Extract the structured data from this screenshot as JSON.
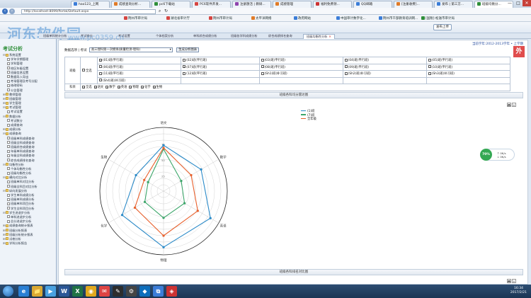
{
  "browser": {
    "tabs": [
      {
        "label": "hao123_上网",
        "color": "#3b7dd8"
      },
      {
        "label": "成绩查询分析...",
        "color": "#e07b28"
      },
      {
        "label": "pc6下载站",
        "color": "#2f8f3a"
      },
      {
        "label": "PC6软件开发...",
        "color": "#d64541"
      },
      {
        "label": "注册激活 | 教研...",
        "color": "#8e44ad"
      },
      {
        "label": "成绩管理",
        "color": "#e07b28"
      },
      {
        "label": "福利免费领...",
        "color": "#c33"
      },
      {
        "label": "QQ邮箱",
        "color": "#3b7dd8"
      },
      {
        "label": "[注册收费]...",
        "color": "#e07b28"
      },
      {
        "label": "发布 | 第三方...",
        "color": "#3b7dd8"
      },
      {
        "label": "班级均衡分...",
        "color": "#2f8f3a"
      }
    ],
    "address": "http://localhost:8099/Portal/Default.aspx",
    "window_controls": [
      "—",
      "□",
      "✕"
    ],
    "favorites": [
      {
        "label": "荆州市审计局",
        "color": "#d64541"
      },
      {
        "label": "湖北省审计厅",
        "color": "#d64541"
      },
      {
        "label": "荆州市审计局",
        "color": "#d64541"
      },
      {
        "label": "太平洋网络",
        "color": "#e07b28"
      },
      {
        "label": "政府网站",
        "color": "#3b7dd8"
      },
      {
        "label": "中国审计数字化...",
        "color": "#3b7dd8"
      },
      {
        "label": "荆州市干部教育培训网...",
        "color": "#3b7dd8"
      },
      {
        "label": "[国税]·松滋市审计局",
        "color": "#2f8f3a"
      }
    ]
  },
  "header": {
    "watermark": "河东软件园",
    "watermark_url": "www.pc0359.cn",
    "upload_label": "发布上传"
  },
  "page_tabs": [
    {
      "label": "班级单科统计分析",
      "active": false
    },
    {
      "label": "考试查分",
      "active": false
    },
    {
      "label": "考试设置",
      "active": false
    },
    {
      "label": "个体档案分析",
      "active": false
    },
    {
      "label": "单科综合成绩分析",
      "active": false
    },
    {
      "label": "班级各学科成绩分析",
      "active": false
    },
    {
      "label": "综合成绩排名查询",
      "active": false
    },
    {
      "label": "班级均衡性分析",
      "active": true
    }
  ],
  "sidebar": {
    "logo": "考试分析",
    "items": [
      {
        "label": "系统设置",
        "level": 1,
        "folder": true,
        "toggle": "⊟"
      },
      {
        "label": "学年学期管理",
        "level": 2,
        "folder": false
      },
      {
        "label": "学科管理",
        "level": 2,
        "folder": false
      },
      {
        "label": "校区年级设置",
        "level": 2,
        "folder": false
      },
      {
        "label": "班级信息设置",
        "level": 2,
        "folder": false
      },
      {
        "label": "数据导入导出",
        "level": 2,
        "folder": false
      },
      {
        "label": "考场管理及考号分配",
        "level": 2,
        "folder": false
      },
      {
        "label": "修改密码",
        "level": 2,
        "folder": false
      },
      {
        "label": "公告管理",
        "level": 2,
        "folder": false
      },
      {
        "label": "教师管理",
        "level": 1,
        "folder": true,
        "toggle": "⊞"
      },
      {
        "label": "班级管理",
        "level": 1,
        "folder": true,
        "toggle": "⊞"
      },
      {
        "label": "学生管理",
        "level": 1,
        "folder": true,
        "toggle": "⊞"
      },
      {
        "label": "考试管理",
        "level": 1,
        "folder": true,
        "toggle": "⊟"
      },
      {
        "label": "考试设置",
        "level": 2,
        "folder": false
      },
      {
        "label": "数据分析",
        "level": 1,
        "folder": true,
        "toggle": "⊟"
      },
      {
        "label": "考试数分",
        "level": 2,
        "folder": false
      },
      {
        "label": "成绩查询",
        "level": 2,
        "folder": false
      },
      {
        "label": "成绩分析",
        "level": 1,
        "folder": true,
        "toggle": "⊞"
      },
      {
        "label": "成绩查询",
        "level": 1,
        "folder": true,
        "toggle": "⊟"
      },
      {
        "label": "班级单科成绩查询",
        "level": 2,
        "folder": false
      },
      {
        "label": "班级全科成绩查询",
        "level": 2,
        "folder": false
      },
      {
        "label": "班级综合成绩查询",
        "level": 2,
        "folder": false
      },
      {
        "label": "年级单科成绩查询",
        "level": 2,
        "folder": false
      },
      {
        "label": "年级全科成绩查询",
        "level": 2,
        "folder": false
      },
      {
        "label": "综合成绩排名查询",
        "level": 2,
        "folder": false
      },
      {
        "label": "均衡性分析",
        "level": 1,
        "folder": true,
        "toggle": "⊟"
      },
      {
        "label": "个体均衡性分析",
        "level": 2,
        "folder": false
      },
      {
        "label": "班级均衡性分析",
        "level": 2,
        "folder": false
      },
      {
        "label": "横向对比分析",
        "level": 1,
        "folder": true,
        "toggle": "⊟"
      },
      {
        "label": "班级单科对比分析",
        "level": 2,
        "folder": false
      },
      {
        "label": "班级全科目对比分析",
        "level": 2,
        "folder": false
      },
      {
        "label": "纵向发展分析",
        "level": 1,
        "folder": true,
        "toggle": "⊟"
      },
      {
        "label": "学生单科成绩分析",
        "level": 2,
        "folder": false
      },
      {
        "label": "班级单科成绩分析",
        "level": 2,
        "folder": false
      },
      {
        "label": "班级单科项目分析",
        "level": 2,
        "folder": false
      },
      {
        "label": "学生全科项目分析",
        "level": 2,
        "folder": false
      },
      {
        "label": "学生进退步分析",
        "level": 1,
        "folder": true,
        "toggle": "⊟"
      },
      {
        "label": "单科进退步分析",
        "level": 2,
        "folder": false
      },
      {
        "label": "总分进退步分析",
        "level": 2,
        "folder": false
      },
      {
        "label": "成绩查询统计报表",
        "level": 1,
        "folder": true,
        "toggle": "⊞"
      },
      {
        "label": "班级分析报表",
        "level": 1,
        "folder": true,
        "toggle": "⊞"
      },
      {
        "label": "班级分析统计报表",
        "level": 1,
        "folder": true,
        "toggle": "⊞"
      },
      {
        "label": "试卷分析",
        "level": 1,
        "folder": true,
        "toggle": "⊞"
      },
      {
        "label": "学科分析报告",
        "level": 1,
        "folder": true,
        "toggle": "⊞"
      }
    ]
  },
  "filter": {
    "prefix": "数据选项 | 考试",
    "exam_value": "高三理科第一次模拟(质量检测-理科)",
    "generate_label": "生成分析图表",
    "term": "当前学年:2012-2013学年 • 上学期",
    "stamp": "外"
  },
  "class_table": {
    "class_header": "班级",
    "subject_header": "科目",
    "select_all": "全选",
    "classes": [
      {
        "label": "(01)班(平行班)",
        "checked": true
      },
      {
        "label": "(02)班(平行班)",
        "checked": false
      },
      {
        "label": "(03)班(平行班)",
        "checked": false
      },
      {
        "label": "(04)班(平行班)",
        "checked": false
      },
      {
        "label": "(05)班(平行班)",
        "checked": false
      },
      {
        "label": "(06)班(平行班)",
        "checked": false
      },
      {
        "label": "(07)班(平行班)",
        "checked": true
      },
      {
        "label": "(08)班(平行班)",
        "checked": false
      },
      {
        "label": "(09)班(平行班)",
        "checked": false
      },
      {
        "label": "(10)班(平行班)",
        "checked": false
      },
      {
        "label": "(11)班(平行班)",
        "checked": false
      },
      {
        "label": "(12)班(平行班)",
        "checked": false
      },
      {
        "label": "(Sh1)班(补习班)",
        "checked": false
      },
      {
        "label": "(Sh2)班(补习班)",
        "checked": false
      },
      {
        "label": "(Sh3)班(补习班)",
        "checked": false
      },
      {
        "label": "(Sh4)班(补习班)",
        "checked": false
      }
    ],
    "subjects": [
      {
        "label": "全选",
        "checked": true
      },
      {
        "label": "语文",
        "checked": true
      },
      {
        "label": "数学",
        "checked": true
      },
      {
        "label": "英语",
        "checked": true
      },
      {
        "label": "物理",
        "checked": true
      },
      {
        "label": "化学",
        "checked": true
      },
      {
        "label": "生物",
        "checked": true
      }
    ]
  },
  "panels": {
    "radar_title": "班级各科均分雷达图",
    "rank_title": "班级各科排名对比图",
    "tool_icons": [
      "🖶",
      "⭳"
    ]
  },
  "chart_data": {
    "type": "radar",
    "title": "班级各科均分雷达图",
    "categories": [
      "语文",
      "数学",
      "英语",
      "物理",
      "化学",
      "生物"
    ],
    "rlim": [
      0,
      100
    ],
    "ring_labels": [
      "25",
      "50",
      "75"
    ],
    "series": [
      {
        "name": "(1)班",
        "color": "#2a8ac8",
        "values": [
          72,
          68,
          85,
          88,
          75,
          50
        ]
      },
      {
        "name": "(7)班",
        "color": "#3ca66a",
        "values": [
          66,
          32,
          38,
          42,
          34,
          28
        ]
      },
      {
        "name": "全年级",
        "color": "#e8602c",
        "values": [
          68,
          50,
          62,
          70,
          52,
          35
        ]
      }
    ],
    "grid": true,
    "legend": "top-right"
  },
  "float_widget": {
    "percent": "70%",
    "up": "0K/s",
    "down": "0K/s"
  },
  "taskbar": {
    "apps": [
      {
        "label": "e",
        "color": "#2a7fd4"
      },
      {
        "label": "📁",
        "color": "#d9a933"
      },
      {
        "label": "▶",
        "color": "#4aa1e0"
      },
      {
        "label": "W",
        "color": "#2b5797"
      },
      {
        "label": "X",
        "color": "#207245"
      },
      {
        "label": "◉",
        "color": "#e0a81e"
      },
      {
        "label": "✉",
        "color": "#d44"
      },
      {
        "label": "✎",
        "color": "#2d2d2d"
      },
      {
        "label": "⚙",
        "color": "#444"
      },
      {
        "label": "◆",
        "color": "#0d6ebc"
      },
      {
        "label": "⧉",
        "color": "#3b7dd8"
      },
      {
        "label": "◈",
        "color": "#c33"
      }
    ],
    "time": "16:34",
    "date": "2017/2/21"
  }
}
